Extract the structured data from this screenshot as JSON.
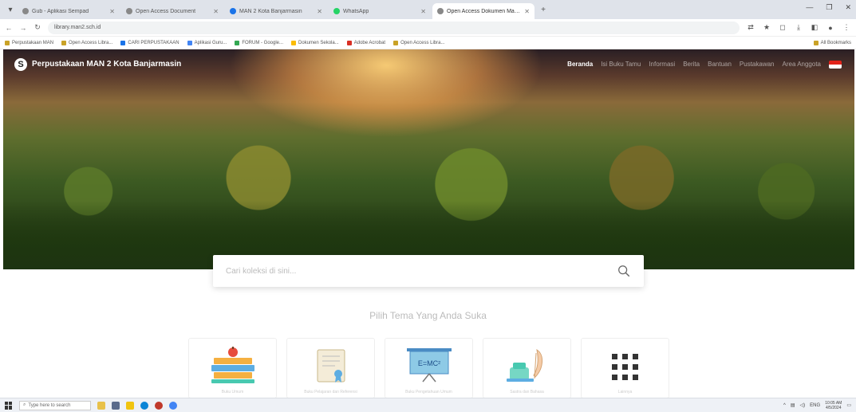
{
  "browser": {
    "tabs": [
      {
        "label": "Gub - Aplikasi Sempad"
      },
      {
        "label": "Open Access Document"
      },
      {
        "label": "MAN 2 Kota Banjarmasin"
      },
      {
        "label": "WhatsApp"
      },
      {
        "label": "Open Access Dokumen Manager",
        "active": true
      }
    ],
    "address": "library.man2.sch.id",
    "bookmarks": [
      "Perpustakaan MAN",
      "Open Access Libra...",
      "CARI PERPUSTAKAAN",
      "Aplikasi Guru...",
      "FORUM - Google...",
      "Dokumen Sekola...",
      "Adobe Acrobat",
      "Open Access Libra..."
    ],
    "bookmarks_right": "All Bookmarks"
  },
  "site": {
    "logo_letter": "S",
    "title": "Perpustakaan MAN 2 Kota Banjarmasin",
    "nav": [
      "Beranda",
      "Isi Buku Tamu",
      "Informasi",
      "Berita",
      "Bantuan",
      "Pustakawan",
      "Area Anggota"
    ]
  },
  "search": {
    "placeholder": "Cari koleksi di sini..."
  },
  "themes": {
    "title": "Pilih Tema Yang Anda Suka",
    "cards": [
      {
        "label": "Buku Umum",
        "icon": "books-icon"
      },
      {
        "label": "Buku Pelajaran dan Referensi",
        "icon": "certificate-icon"
      },
      {
        "label": "Buku Pengetahuan Umum",
        "icon": "presentation-board-icon"
      },
      {
        "label": "Sastra dan Bahasa",
        "icon": "ink-quill-icon"
      },
      {
        "label": "Lainnya",
        "icon": "grid-icon"
      }
    ]
  },
  "taskbar": {
    "search_placeholder": "Type here to search",
    "clock_time": "10:05 AM",
    "clock_date": "4/5/2024"
  }
}
